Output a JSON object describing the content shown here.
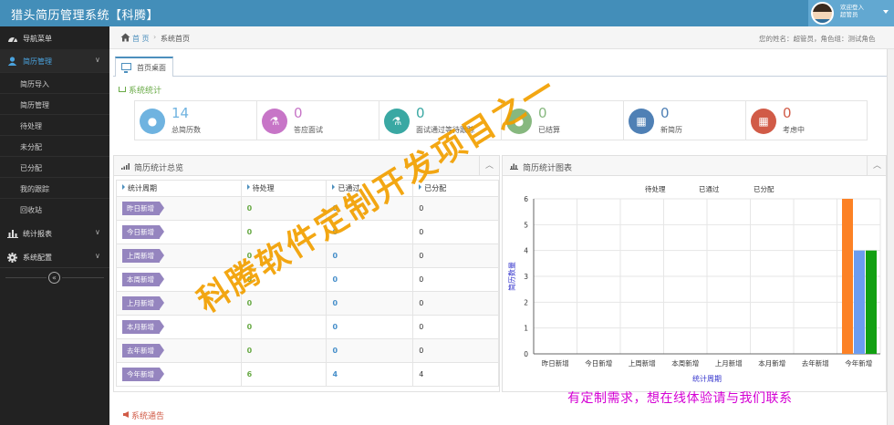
{
  "app": {
    "title": "猎头简历管理系统【科腾】"
  },
  "user": {
    "welcome": "欢迎登入",
    "name": "超管员"
  },
  "sidebar": {
    "items": [
      {
        "icon": "dashboard-icon",
        "label": "导航菜单"
      },
      {
        "icon": "user-icon",
        "label": "简历管理"
      },
      {
        "icon": "bar-chart-icon",
        "label": "统计报表"
      },
      {
        "icon": "gear-icon",
        "label": "系统配置"
      }
    ],
    "sub_items": [
      "简历导入",
      "简历管理",
      "待处理",
      "未分配",
      "已分配",
      "我的跟踪",
      "回收站"
    ],
    "collapse_glyph": "«"
  },
  "breadcrumb": {
    "home": "首 页",
    "separator": "›",
    "current": "系统首页",
    "user_info": "您的姓名：超管员，角色组：测试角色"
  },
  "tab": {
    "label": "首页桌面"
  },
  "stats": {
    "title": "系统统计",
    "items": [
      {
        "value": "14",
        "label": "总简历数",
        "color": "#6fb3e0",
        "icon": "chat-icon"
      },
      {
        "value": "0",
        "label": "答应面试",
        "color": "#c775c7",
        "icon": "flask-icon"
      },
      {
        "value": "0",
        "label": "面试通过等待跟踪",
        "color": "#3aa8a3",
        "icon": "flask-icon"
      },
      {
        "value": "0",
        "label": "已结算",
        "color": "#87b87f",
        "icon": "chat-icon"
      },
      {
        "value": "0",
        "label": "新简历",
        "color": "#4f80b5",
        "icon": "calendar-icon"
      },
      {
        "value": "0",
        "label": "考虑中",
        "color": "#d15b47",
        "icon": "calendar-icon"
      }
    ]
  },
  "summary": {
    "title": "简历统计总览",
    "columns": [
      "统计周期",
      "待处理",
      "已通过",
      "已分配"
    ],
    "rows": [
      {
        "period": "昨日新增",
        "pending": "0",
        "passed": "0",
        "assigned": "0"
      },
      {
        "period": "今日新增",
        "pending": "0",
        "passed": "0",
        "assigned": "0"
      },
      {
        "period": "上周新增",
        "pending": "0",
        "passed": "0",
        "assigned": "0"
      },
      {
        "period": "本周新增",
        "pending": "0",
        "passed": "0",
        "assigned": "0"
      },
      {
        "period": "上月新增",
        "pending": "0",
        "passed": "0",
        "assigned": "0"
      },
      {
        "period": "本月新增",
        "pending": "0",
        "passed": "0",
        "assigned": "0"
      },
      {
        "period": "去年新增",
        "pending": "0",
        "passed": "0",
        "assigned": "0"
      },
      {
        "period": "今年新增",
        "pending": "6",
        "passed": "4",
        "assigned": "4"
      }
    ]
  },
  "chart_panel": {
    "title": "简历统计图表"
  },
  "chart_data": {
    "type": "bar",
    "categories": [
      "昨日新增",
      "今日新增",
      "上周新增",
      "本周新增",
      "上月新增",
      "本月新增",
      "去年新增",
      "今年新增"
    ],
    "series": [
      {
        "name": "待处理",
        "values": [
          0,
          0,
          0,
          0,
          0,
          0,
          0,
          6
        ],
        "color": "#fc8125"
      },
      {
        "name": "已通过",
        "values": [
          0,
          0,
          0,
          0,
          0,
          0,
          0,
          4
        ],
        "color": "#6b9cf0"
      },
      {
        "name": "已分配",
        "values": [
          0,
          0,
          0,
          0,
          0,
          0,
          0,
          4
        ],
        "color": "#12a012"
      }
    ],
    "xlabel": "统计周期",
    "ylabel": "简历数量",
    "ylim": [
      0,
      6
    ],
    "yticks": [
      0,
      1,
      2,
      3,
      4,
      5,
      6
    ],
    "grid": true,
    "legend": "top-center"
  },
  "footer": {
    "notice": "系统通告",
    "contact": "有定制需求，想在线体验请与我们联系"
  },
  "watermark": {
    "text": "科腾软件定制开发项目之一"
  }
}
